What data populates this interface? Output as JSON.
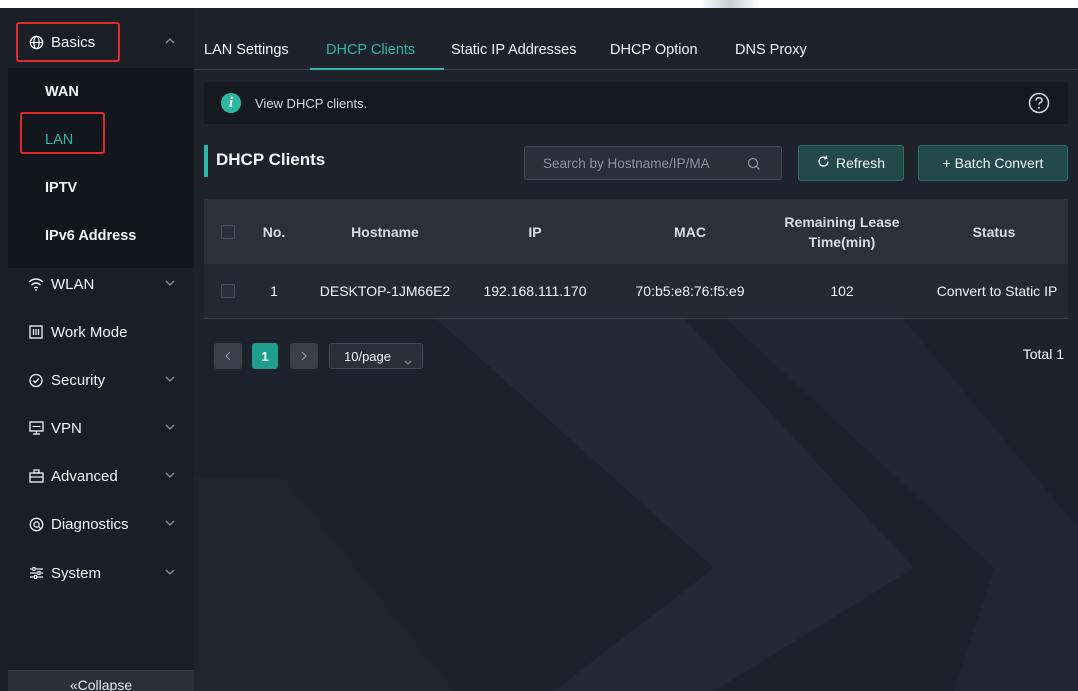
{
  "sidebar": {
    "groups": [
      {
        "label": "Basics",
        "icon": "globe-icon",
        "expanded": true
      },
      {
        "label": "WLAN",
        "icon": "wifi-icon"
      },
      {
        "label": "Work Mode",
        "icon": "workmode-icon"
      },
      {
        "label": "Security",
        "icon": "shield-icon"
      },
      {
        "label": "VPN",
        "icon": "vpn-icon"
      },
      {
        "label": "Advanced",
        "icon": "toolbox-icon"
      },
      {
        "label": "Diagnostics",
        "icon": "diagnostics-icon"
      },
      {
        "label": "System",
        "icon": "sliders-icon"
      }
    ],
    "basics_items": [
      {
        "label": "WAN"
      },
      {
        "label": "LAN",
        "active": true
      },
      {
        "label": "IPTV"
      },
      {
        "label": "IPv6 Address"
      }
    ],
    "collapse_label": "«Collapse"
  },
  "tabs": [
    {
      "label": "LAN Settings"
    },
    {
      "label": "DHCP Clients",
      "active": true
    },
    {
      "label": "Static IP Addresses"
    },
    {
      "label": "DHCP Option"
    },
    {
      "label": "DNS Proxy"
    }
  ],
  "info": {
    "text": "View DHCP clients."
  },
  "section": {
    "title": "DHCP Clients"
  },
  "search": {
    "placeholder": "Search by Hostname/IP/MA",
    "value": ""
  },
  "buttons": {
    "refresh": "Refresh",
    "batch_convert": "+ Batch Convert"
  },
  "table": {
    "headers": {
      "no": "No.",
      "hostname": "Hostname",
      "ip": "IP",
      "mac": "MAC",
      "lease_line1": "Remaining Lease",
      "lease_line2": "Time(min)",
      "status": "Status"
    },
    "rows": [
      {
        "no": "1",
        "hostname": "DESKTOP-1JM66E2",
        "ip": "192.168.111.170",
        "mac": "70:b5:e8:76:f5:e9",
        "lease": "102",
        "action": "Convert to Static IP"
      }
    ]
  },
  "pagination": {
    "current_page": "1",
    "page_size": "10/page",
    "total": "Total 1"
  },
  "colors": {
    "accent": "#2fb7a6",
    "highlight": "#e02b2b",
    "background": "#1d222b"
  }
}
